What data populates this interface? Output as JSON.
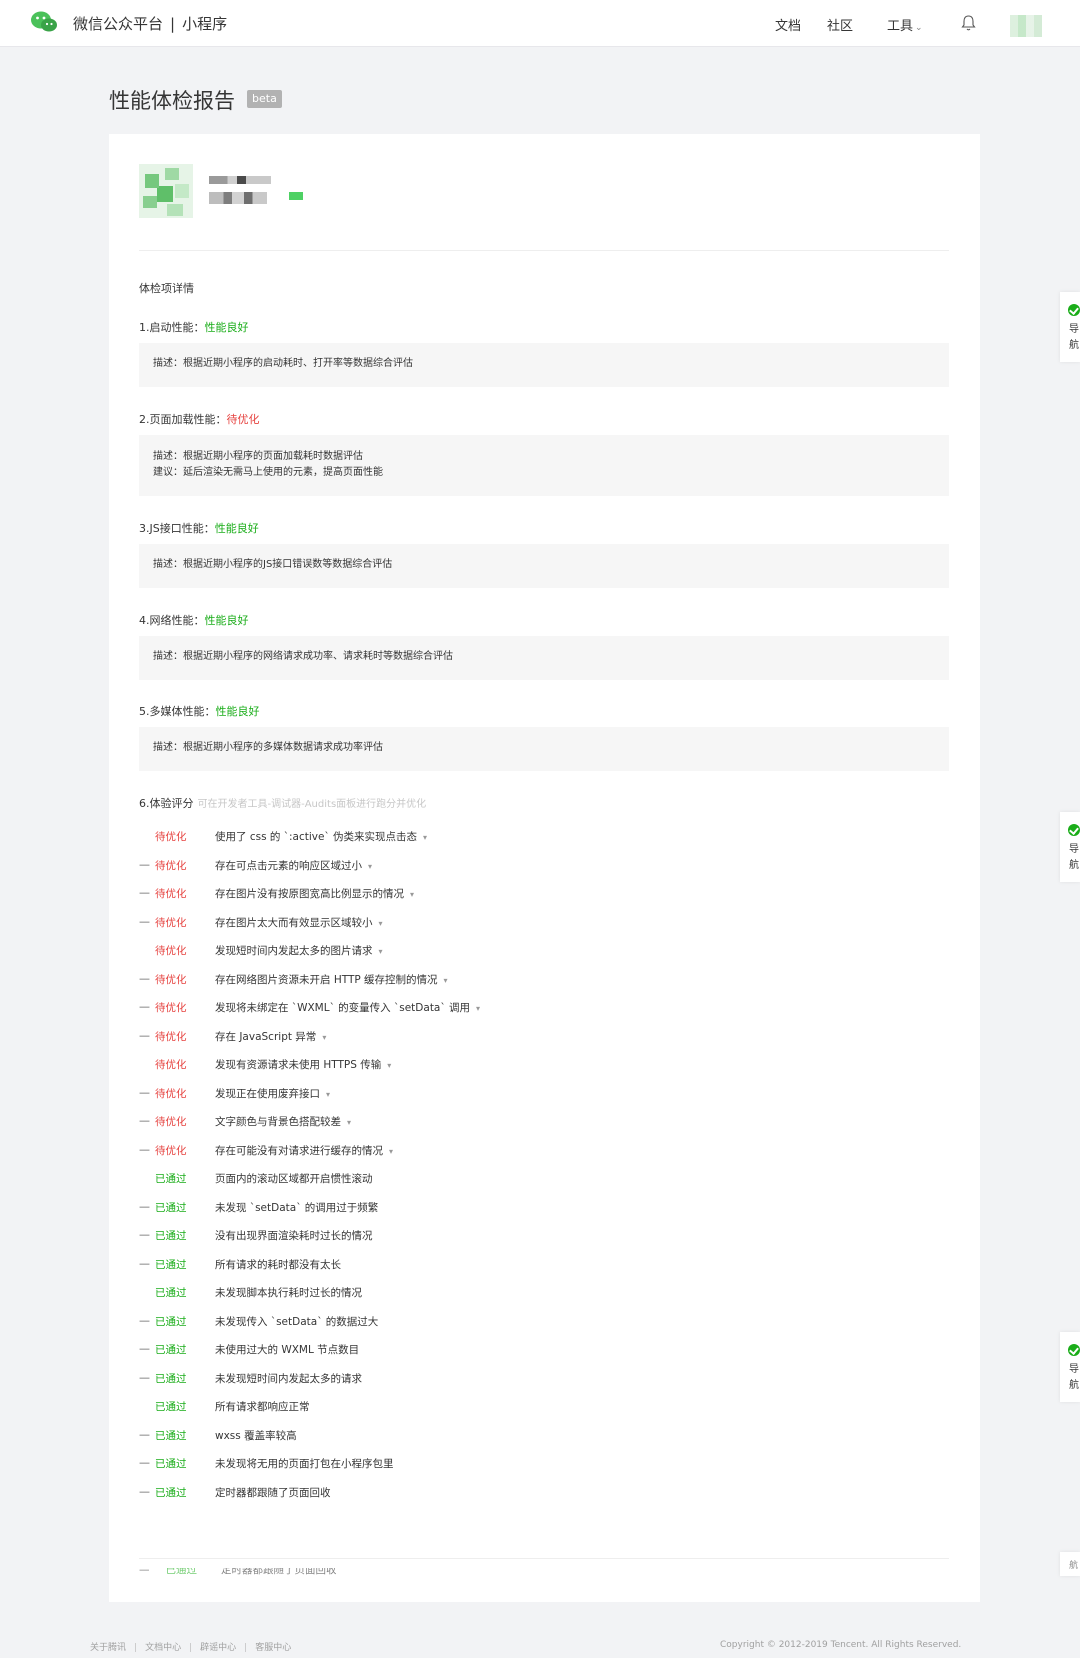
{
  "header": {
    "platform_name": "微信公众平台",
    "separator": "|",
    "section_name": "小程序",
    "nav": {
      "docs": "文档",
      "community": "社区",
      "tools": "工具"
    },
    "icons": {
      "logo": "wechat-logo-icon",
      "bell": "bell-icon",
      "tools_chevron": "chevron-down-icon"
    }
  },
  "page": {
    "title": "性能体检报告",
    "badge": "beta"
  },
  "report": {
    "section_heading": "体检项详情",
    "items": [
      {
        "title": "1.启动性能：",
        "status": "性能良好",
        "status_type": "good",
        "lines": [
          "描述：根据近期小程序的启动耗时、打开率等数据综合评估"
        ]
      },
      {
        "title": "2.页面加载性能：",
        "status": "待优化",
        "status_type": "bad",
        "lines": [
          "描述：根据近期小程序的页面加载耗时数据评估",
          "建议：延后渲染无需马上使用的元素，提高页面性能"
        ]
      },
      {
        "title": "3.JS接口性能：",
        "status": "性能良好",
        "status_type": "good",
        "lines": [
          "描述：根据近期小程序的JS接口错误数等数据综合评估"
        ]
      },
      {
        "title": "4.网络性能：",
        "status": "性能良好",
        "status_type": "good",
        "lines": [
          "描述：根据近期小程序的网络请求成功率、请求耗时等数据综合评估"
        ]
      },
      {
        "title": "5.多媒体性能：",
        "status": "性能良好",
        "status_type": "good",
        "lines": [
          "描述：根据近期小程序的多媒体数据请求成功率评估"
        ]
      }
    ],
    "experience": {
      "title": "6.体验评分",
      "hint": "可在开发者工具-调试器-Audits面板进行跑分并优化",
      "audits": [
        {
          "dash": false,
          "status": "待优化",
          "status_type": "bad",
          "text": "使用了 css 的 `:active` 伪类来实现点击态",
          "expandable": true
        },
        {
          "dash": true,
          "status": "待优化",
          "status_type": "bad",
          "text": "存在可点击元素的响应区域过小",
          "expandable": true
        },
        {
          "dash": true,
          "status": "待优化",
          "status_type": "bad",
          "text": "存在图片没有按原图宽高比例显示的情况",
          "expandable": true
        },
        {
          "dash": true,
          "status": "待优化",
          "status_type": "bad",
          "text": "存在图片太大而有效显示区域较小",
          "expandable": true
        },
        {
          "dash": false,
          "status": "待优化",
          "status_type": "bad",
          "text": "发现短时间内发起太多的图片请求",
          "expandable": true
        },
        {
          "dash": true,
          "status": "待优化",
          "status_type": "bad",
          "text": "存在网络图片资源未开启 HTTP 缓存控制的情况",
          "expandable": true
        },
        {
          "dash": true,
          "status": "待优化",
          "status_type": "bad",
          "text": "发现将未绑定在 `WXML` 的变量传入 `setData` 调用",
          "expandable": true
        },
        {
          "dash": true,
          "status": "待优化",
          "status_type": "bad",
          "text": "存在 JavaScript 异常",
          "expandable": true
        },
        {
          "dash": false,
          "status": "待优化",
          "status_type": "bad",
          "text": "发现有资源请求未使用 HTTPS 传输",
          "expandable": true
        },
        {
          "dash": true,
          "status": "待优化",
          "status_type": "bad",
          "text": "发现正在使用废弃接口",
          "expandable": true
        },
        {
          "dash": true,
          "status": "待优化",
          "status_type": "bad",
          "text": "文字颜色与背景色搭配较差",
          "expandable": true
        },
        {
          "dash": true,
          "status": "待优化",
          "status_type": "bad",
          "text": "存在可能没有对请求进行缓存的情况",
          "expandable": true
        },
        {
          "dash": false,
          "status": "已通过",
          "status_type": "good",
          "text": "页面内的滚动区域都开启惯性滚动",
          "expandable": false
        },
        {
          "dash": true,
          "status": "已通过",
          "status_type": "good",
          "text": "未发现 `setData` 的调用过于频繁",
          "expandable": false
        },
        {
          "dash": true,
          "status": "已通过",
          "status_type": "good",
          "text": "没有出现界面渲染耗时过长的情况",
          "expandable": false
        },
        {
          "dash": true,
          "status": "已通过",
          "status_type": "good",
          "text": "所有请求的耗时都没有太长",
          "expandable": false
        },
        {
          "dash": false,
          "status": "已通过",
          "status_type": "good",
          "text": "未发现脚本执行耗时过长的情况",
          "expandable": false
        },
        {
          "dash": true,
          "status": "已通过",
          "status_type": "good",
          "text": "未发现传入 `setData` 的数据过大",
          "expandable": false
        },
        {
          "dash": true,
          "status": "已通过",
          "status_type": "good",
          "text": "未使用过大的 WXML 节点数目",
          "expandable": false
        },
        {
          "dash": true,
          "status": "已通过",
          "status_type": "good",
          "text": "未发现短时间内发起太多的请求",
          "expandable": false
        },
        {
          "dash": false,
          "status": "已通过",
          "status_type": "good",
          "text": "所有请求都响应正常",
          "expandable": false
        },
        {
          "dash": true,
          "status": "已通过",
          "status_type": "good",
          "text": "wxss 覆盖率较高",
          "expandable": false
        },
        {
          "dash": true,
          "status": "已通过",
          "status_type": "good",
          "text": "未发现将无用的页面打包在小程序包里",
          "expandable": false
        },
        {
          "dash": true,
          "status": "已通过",
          "status_type": "good",
          "text": "定时器都跟随了页面回收",
          "expandable": false
        }
      ],
      "cutoff_row": {
        "status": "已通过",
        "text": "定时器都跟随了页面回收"
      }
    }
  },
  "side_tabs": [
    {
      "line1": "导",
      "line2": "航"
    },
    {
      "line1": "导",
      "line2": "航"
    },
    {
      "line1": "导",
      "line2": "航"
    }
  ],
  "side_tab_small": "航",
  "footer": {
    "links": [
      "关于腾讯",
      "文档中心",
      "辟谣中心",
      "客服中心"
    ],
    "copyright": "Copyright © 2012-2019 Tencent. All Rights Reserved."
  },
  "colors": {
    "good": "#1aad19",
    "bad": "#e64340",
    "background": "#f2f3f5"
  },
  "caret_glyph": "▾",
  "dash_glyph": "—"
}
